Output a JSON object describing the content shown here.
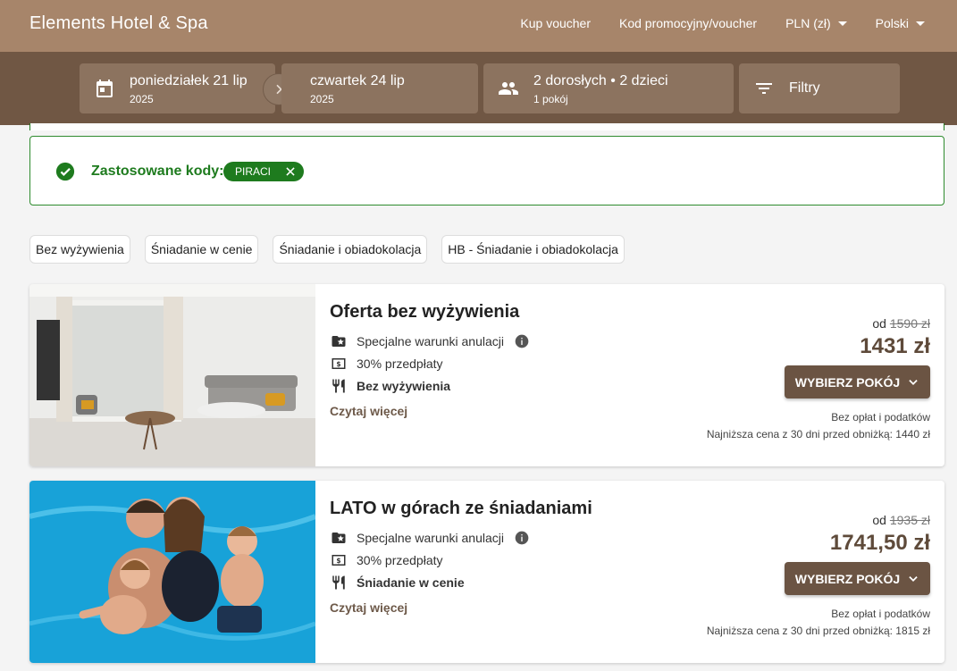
{
  "header": {
    "brand": "Elements Hotel & Spa",
    "nav": {
      "voucher": "Kup voucher",
      "promo": "Kod promocyjny/voucher",
      "currency": "PLN (zł)",
      "language": "Polski"
    }
  },
  "search": {
    "checkin": {
      "day": "poniedziałek 21 lip",
      "year": "2025"
    },
    "checkout": {
      "day": "czwartek 24 lip",
      "year": "2025"
    },
    "guests": {
      "main": "2 dorosłych • 2 dzieci",
      "sub": "1 pokój"
    },
    "filters_label": "Filtry"
  },
  "applied_codes": {
    "label": "Zastosowane kody:",
    "codes": [
      "PIRACI"
    ]
  },
  "board_filters": [
    "Bez wyżywienia",
    "Śniadanie w cenie",
    "Śniadanie i obiadokolacja",
    "HB - Śniadanie i obiadokolacja"
  ],
  "offers": [
    {
      "title": "Oferta bez wyżywienia",
      "cancellation": "Specjalne warunki anulacji",
      "prepayment": "30% przedpłaty",
      "board": "Bez wyżywienia",
      "read_more": "Czytaj więcej",
      "from_label": "od",
      "old_price": "1590 zł",
      "price": "1431 zł",
      "button": "WYBIERZ POKÓJ",
      "note_fees": "Bez opłat i podatków",
      "note_lowest": "Najniższa cena z 30 dni przed obniżką: 1440 zł"
    },
    {
      "title": "LATO w górach ze śniadaniami",
      "cancellation": "Specjalne warunki anulacji",
      "prepayment": "30% przedpłaty",
      "board": "Śniadanie w cenie",
      "read_more": "Czytaj więcej",
      "from_label": "od",
      "old_price": "1935 zł",
      "price": "1741,50 zł",
      "button": "WYBIERZ POKÓJ",
      "note_fees": "Bez opłat i podatków",
      "note_lowest": "Najniższa cena z 30 dni przed obniżką: 1815 zł"
    }
  ],
  "colors": {
    "header": "#a7856a",
    "searchbar": "#705744",
    "accent_green": "#1e7b1e",
    "button": "#6b5443"
  }
}
